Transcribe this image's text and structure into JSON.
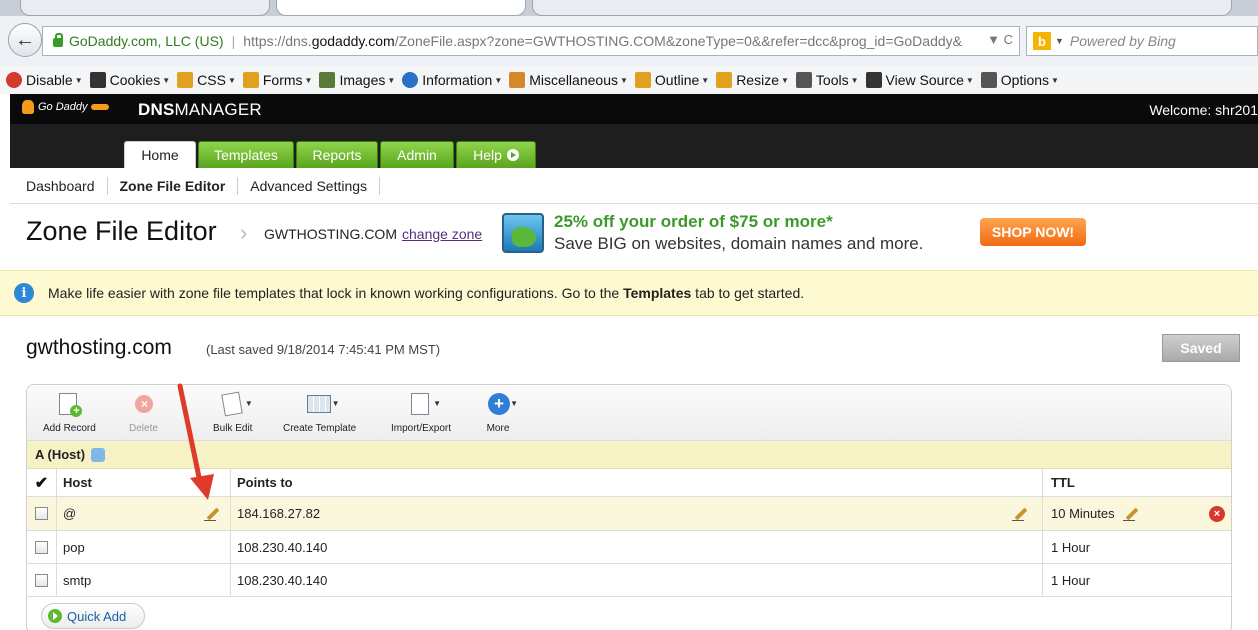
{
  "browser": {
    "site_identity": "GoDaddy.com, LLC (US)",
    "url_prefix": "https://dns.",
    "url_host": "godaddy.com",
    "url_suffix": "/ZoneFile.aspx?zone=GWTHOSTING.COM&zoneType=0&&refer=dcc&prog_id=GoDaddy&",
    "url_tail": "▼ C",
    "search_placeholder": "Powered by Bing",
    "toolbar": [
      {
        "label": "Disable",
        "icon": "disable-icon",
        "color": "#d33a2c"
      },
      {
        "label": "Cookies",
        "icon": "cookies-icon",
        "color": "#333333"
      },
      {
        "label": "CSS",
        "icon": "css-icon",
        "color": "#e0a020"
      },
      {
        "label": "Forms",
        "icon": "forms-icon",
        "color": "#e0a020"
      },
      {
        "label": "Images",
        "icon": "images-icon",
        "color": "#5a7a3a"
      },
      {
        "label": "Information",
        "icon": "information-icon",
        "color": "#2b6fc8"
      },
      {
        "label": "Miscellaneous",
        "icon": "miscellaneous-icon",
        "color": "#d6872a"
      },
      {
        "label": "Outline",
        "icon": "outline-icon",
        "color": "#e0a020"
      },
      {
        "label": "Resize",
        "icon": "resize-icon",
        "color": "#e0a020"
      },
      {
        "label": "Tools",
        "icon": "tools-icon",
        "color": "#555555"
      },
      {
        "label": "View Source",
        "icon": "view-source-icon",
        "color": "#333333"
      },
      {
        "label": "Options",
        "icon": "options-icon",
        "color": "#555555"
      }
    ]
  },
  "header": {
    "logo_text": "Go Daddy",
    "product_bold": "DNS",
    "product_rest": "MANAGER",
    "welcome": "Welcome: shr201"
  },
  "nav": {
    "tabs": [
      {
        "label": "Home",
        "active": true
      },
      {
        "label": "Templates"
      },
      {
        "label": "Reports"
      },
      {
        "label": "Admin"
      },
      {
        "label": "Help"
      }
    ]
  },
  "subnav": {
    "items": [
      "Dashboard",
      "Zone File Editor",
      "Advanced Settings"
    ]
  },
  "page": {
    "title": "Zone File Editor",
    "zone": "GWTHOSTING.COM",
    "change_zone": "change zone"
  },
  "ad": {
    "line1": "25% off your order of $75 or more*",
    "line2": "Save BIG on websites, domain names and more.",
    "cta": "SHOP NOW!"
  },
  "info": {
    "text_before": "Make life easier with zone file templates that lock in known working configurations. Go to the ",
    "text_bold": "Templates",
    "text_after": " tab to get started."
  },
  "domain": {
    "name": "gwthosting.com",
    "last_saved": "(Last saved 9/18/2014 7:45:41 PM MST)",
    "saved_button": "Saved"
  },
  "tools": [
    {
      "label": "Add Record",
      "icon": "add-record-icon"
    },
    {
      "label": "Delete",
      "icon": "delete-icon",
      "disabled": true
    },
    {
      "label": "Bulk Edit",
      "icon": "bulk-edit-icon"
    },
    {
      "label": "Create Template",
      "icon": "create-template-icon"
    },
    {
      "label": "Import/Export",
      "icon": "import-export-icon"
    },
    {
      "label": "More",
      "icon": "more-icon"
    }
  ],
  "records": {
    "section": "A (Host)",
    "columns": {
      "host": "Host",
      "points_to": "Points to",
      "ttl": "TTL"
    },
    "rows": [
      {
        "host": "@",
        "points_to": "184.168.27.82",
        "ttl": "10 Minutes"
      },
      {
        "host": "pop",
        "points_to": "108.230.40.140",
        "ttl": "1 Hour"
      },
      {
        "host": "smtp",
        "points_to": "108.230.40.140",
        "ttl": "1 Hour"
      }
    ],
    "quick_add": "Quick Add"
  }
}
